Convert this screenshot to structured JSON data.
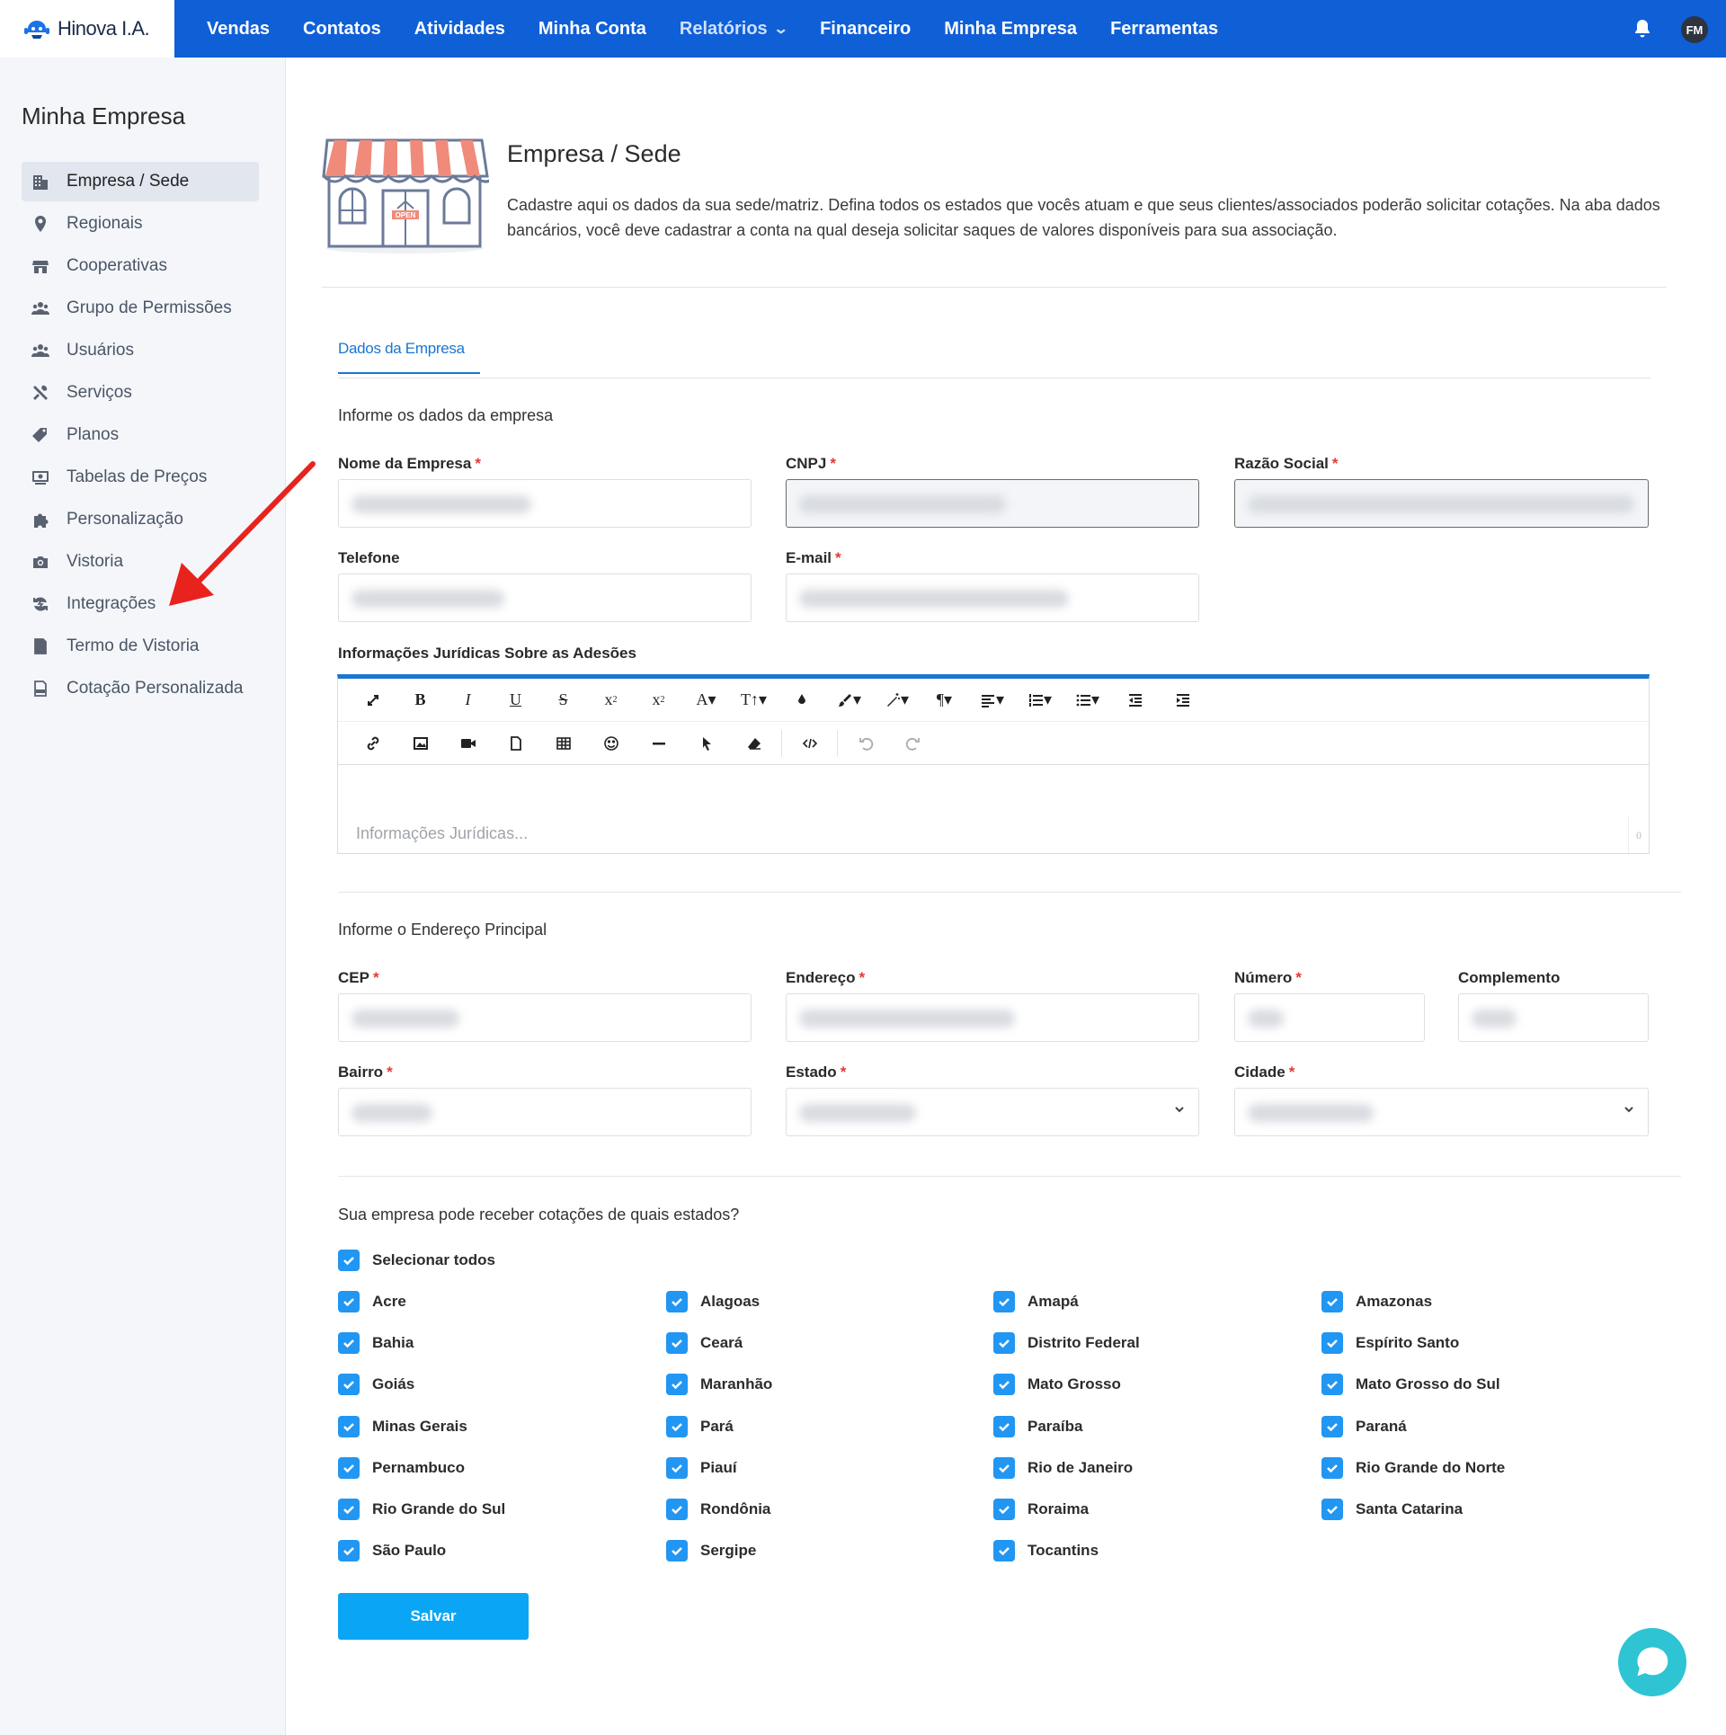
{
  "brand": {
    "name": "Hinova I.A."
  },
  "nav": {
    "items": [
      "Vendas",
      "Contatos",
      "Atividades",
      "Minha Conta",
      "Relatórios",
      "Financeiro",
      "Minha Empresa",
      "Ferramentas"
    ],
    "avatar_initials": "FM"
  },
  "sidebar": {
    "title": "Minha Empresa",
    "items": [
      {
        "label": "Empresa / Sede",
        "icon": "building-icon"
      },
      {
        "label": "Regionais",
        "icon": "map-pin-icon"
      },
      {
        "label": "Cooperativas",
        "icon": "store-icon"
      },
      {
        "label": "Grupo de Permissões",
        "icon": "users-icon"
      },
      {
        "label": "Usuários",
        "icon": "users-icon"
      },
      {
        "label": "Serviços",
        "icon": "tools-icon"
      },
      {
        "label": "Planos",
        "icon": "tags-icon"
      },
      {
        "label": "Tabelas de Preços",
        "icon": "price-table-icon"
      },
      {
        "label": "Personalização",
        "icon": "puzzle-icon"
      },
      {
        "label": "Vistoria",
        "icon": "camera-icon"
      },
      {
        "label": "Integrações",
        "icon": "sync-icon"
      },
      {
        "label": "Termo de Vistoria",
        "icon": "document-icon"
      },
      {
        "label": "Cotação Personalizada",
        "icon": "pdf-icon"
      }
    ]
  },
  "header": {
    "title": "Empresa / Sede",
    "description": "Cadastre aqui os dados da sua sede/matriz. Defina todos os estados que vocês atuam e que seus clientes/associados poderão solicitar cotações. Na aba dados bancários, você deve cadastrar a conta na qual deseja solicitar saques de valores disponíveis para sua associação.",
    "store_sign": "OPEN"
  },
  "tabs": {
    "active": "Dados da Empresa"
  },
  "company": {
    "section_title": "Informe os dados da empresa",
    "fields": {
      "nome": "Nome da Empresa",
      "cnpj": "CNPJ",
      "razao": "Razão Social",
      "telefone": "Telefone",
      "email": "E-mail"
    },
    "required_mark": "*",
    "juridico_label": "Informações Jurídicas Sobre as Adesões",
    "juridico_placeholder": "Informações Jurídicas...",
    "char_count": "0"
  },
  "address": {
    "section_title": "Informe o Endereço Principal",
    "fields": {
      "cep": "CEP",
      "endereco": "Endereço",
      "numero": "Número",
      "complemento": "Complemento",
      "bairro": "Bairro",
      "estado": "Estado",
      "cidade": "Cidade"
    }
  },
  "states": {
    "question": "Sua empresa pode receber cotações de quais estados?",
    "select_all": "Selecionar todos",
    "list": [
      "Acre",
      "Alagoas",
      "Amapá",
      "Amazonas",
      "Bahia",
      "Ceará",
      "Distrito Federal",
      "Espírito Santo",
      "Goiás",
      "Maranhão",
      "Mato Grosso",
      "Mato Grosso do Sul",
      "Minas Gerais",
      "Pará",
      "Paraíba",
      "Paraná",
      "Pernambuco",
      "Piauí",
      "Rio de Janeiro",
      "Rio Grande do Norte",
      "Rio Grande do Sul",
      "Rondônia",
      "Roraima",
      "Santa Catarina",
      "São Paulo",
      "Sergipe",
      "Tocantins"
    ],
    "all_checked": true
  },
  "actions": {
    "save": "Salvar"
  },
  "colors": {
    "primary": "#0f5fd7",
    "accent": "#1976d2",
    "checkbox": "#2196f3",
    "save": "#0aa6f5",
    "chat": "#2ec4d4",
    "arrow": "#e8231d"
  }
}
